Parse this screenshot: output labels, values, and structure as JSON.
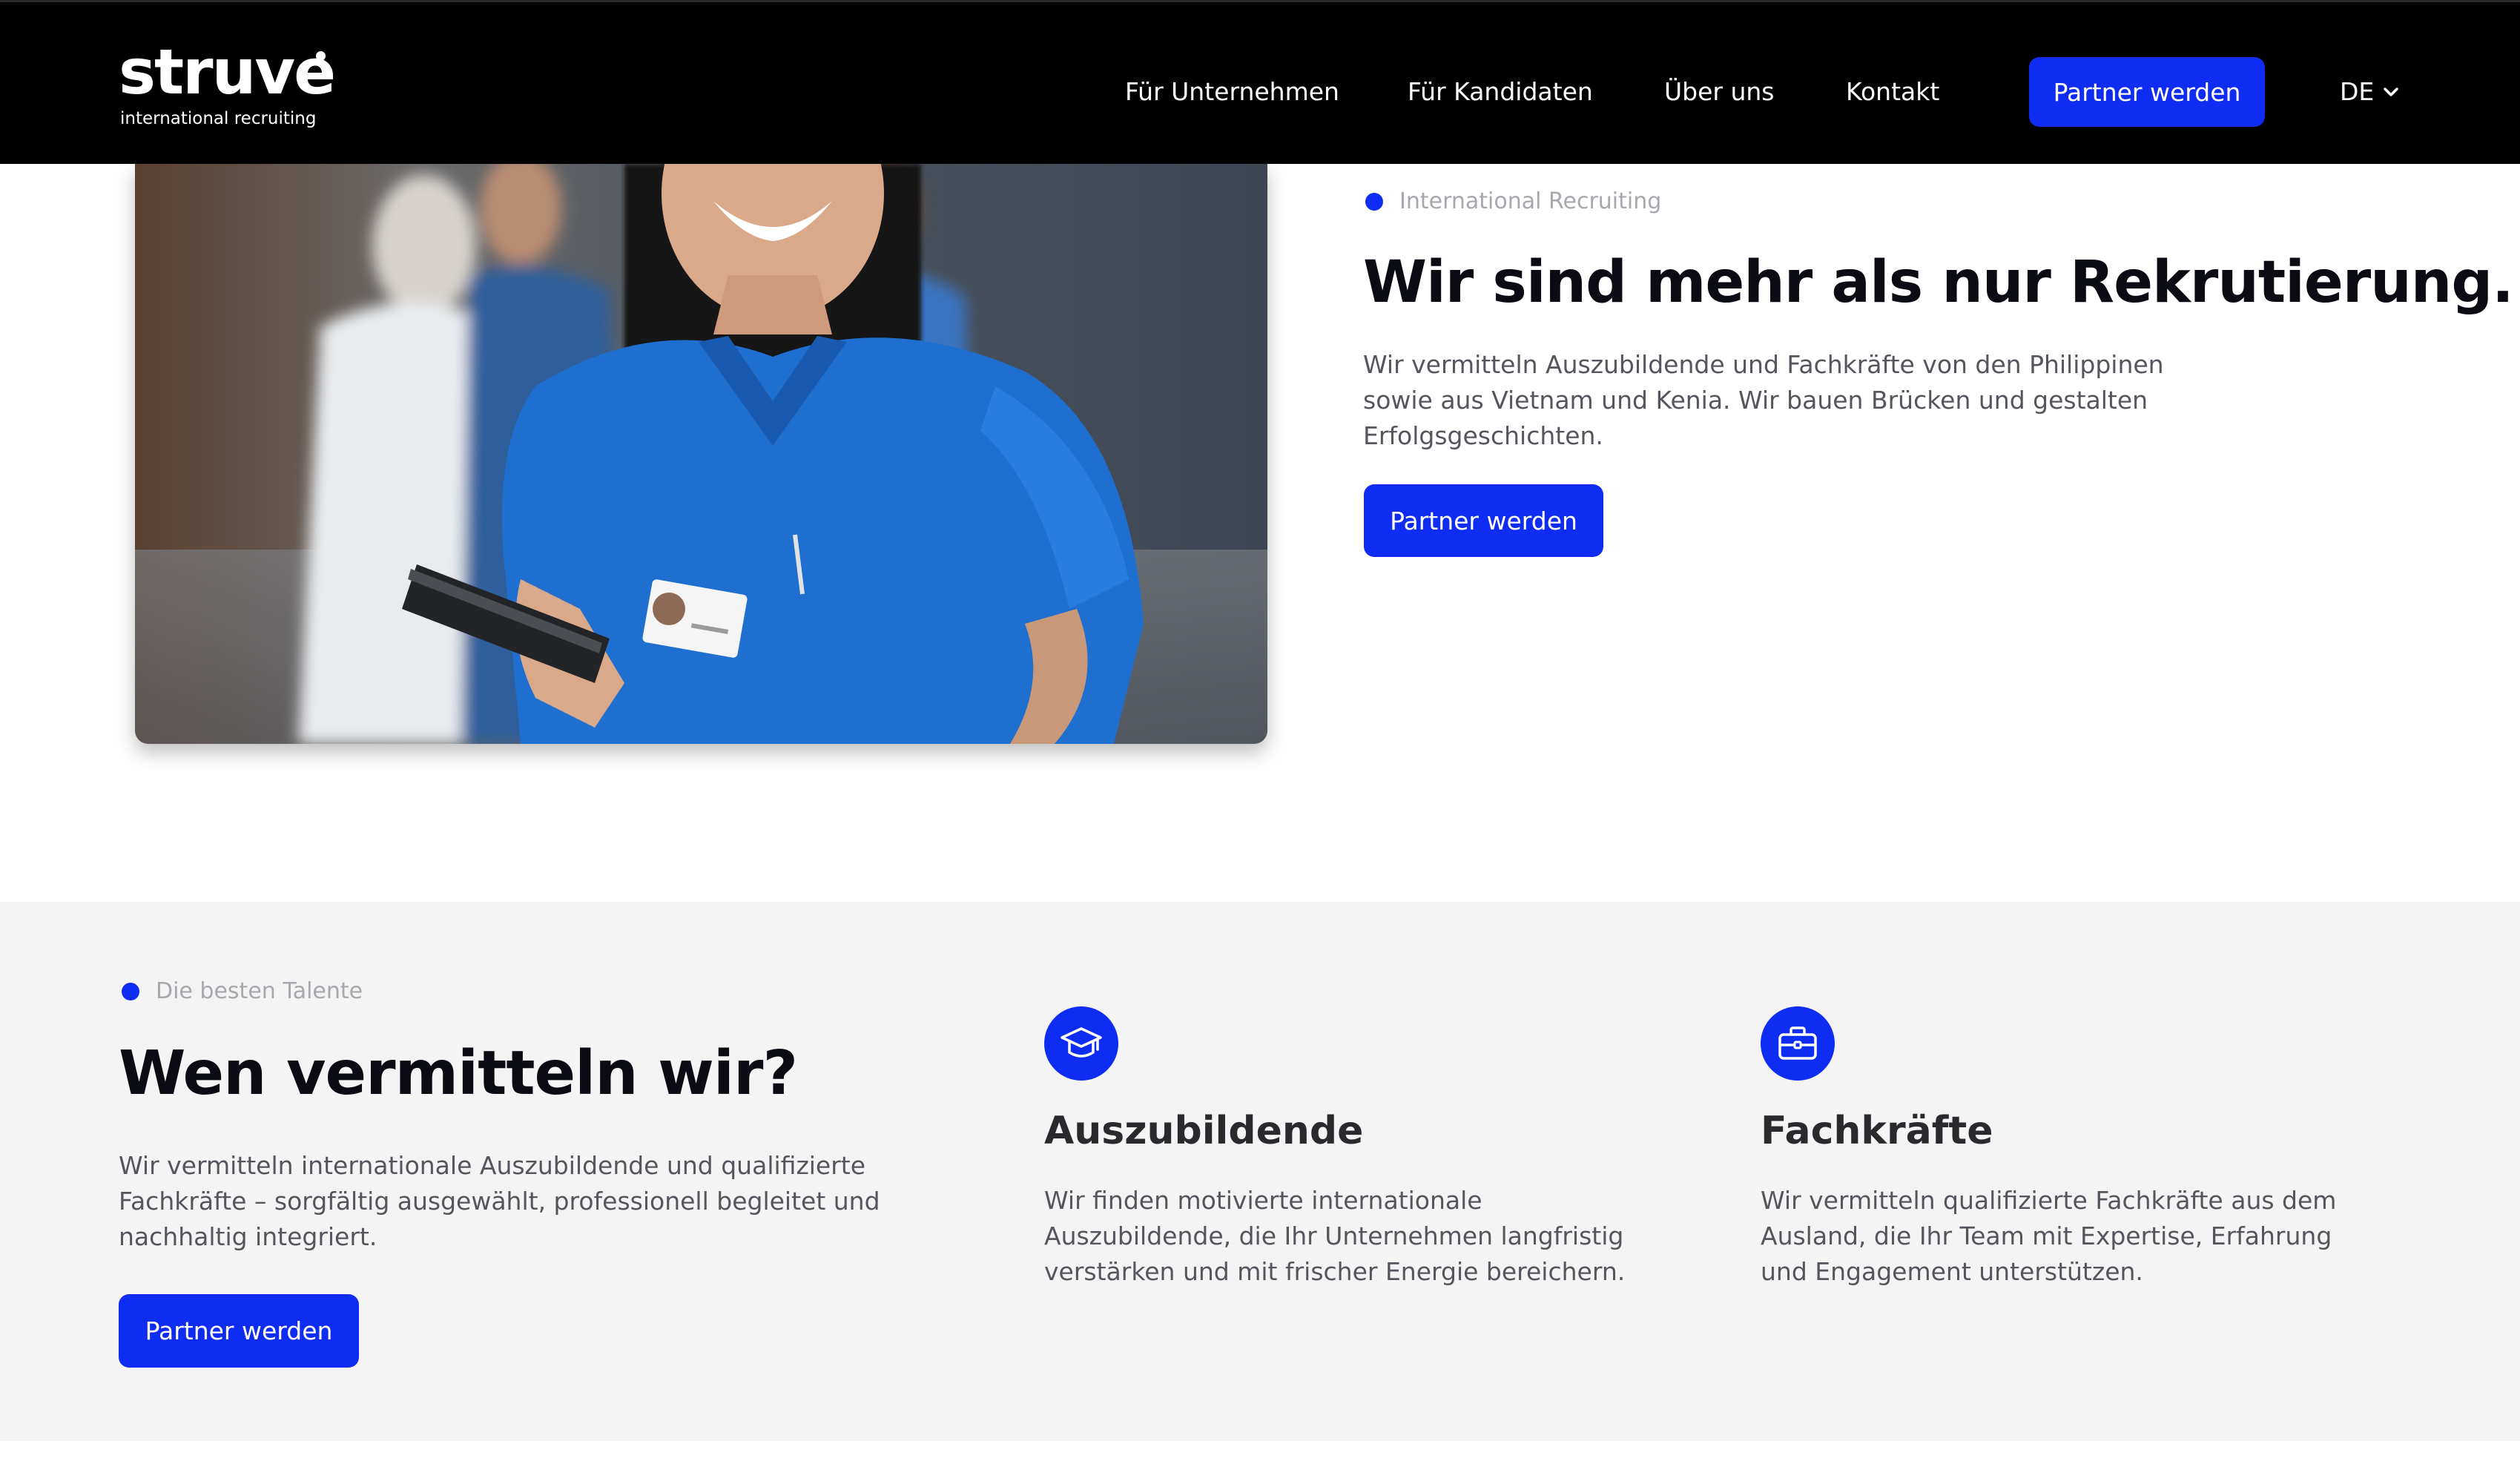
{
  "brand": {
    "name": "struve",
    "tagline": "international recruiting",
    "accent_color": "#0f2cf2"
  },
  "nav": {
    "items": [
      {
        "label": "Für Unternehmen"
      },
      {
        "label": "Für Kandidaten"
      },
      {
        "label": "Über uns"
      },
      {
        "label": "Kontakt"
      }
    ],
    "cta_label": "Partner werden",
    "language": "DE",
    "language_icon": "chevron-down-icon"
  },
  "hero": {
    "eyebrow": "International Recruiting",
    "title": "Wir sind mehr als nur Rekrutierung.",
    "text": "Wir vermitteln Auszubildende und Fachkräfte von den Philippinen sowie aus Vietnam und Kenia. Wir bauen Brücken und gestalten Erfolgsgeschichten.",
    "cta_label": "Partner werden"
  },
  "talent": {
    "eyebrow": "Die besten Talente",
    "title": "Wen vermitteln wir?",
    "text": "Wir vermitteln internationale Auszubildende und qualifizierte Fachkräfte – sorgfältig ausgewählt, professionell begleitet und nachhaltig integriert.",
    "cta_label": "Partner werden",
    "features": [
      {
        "icon": "graduation-cap-icon",
        "title": "Auszubildende",
        "text": "Wir finden motivierte internationale Auszubildende, die Ihr Unternehmen langfristig verstärken und mit frischer Energie bereichern."
      },
      {
        "icon": "briefcase-icon",
        "title": "Fachkräfte",
        "text": "Wir vermitteln qualifizierte Fachkräfte aus dem Ausland, die Ihr Team mit Expertise, Erfahrung und Engagement unterstützen."
      }
    ]
  }
}
